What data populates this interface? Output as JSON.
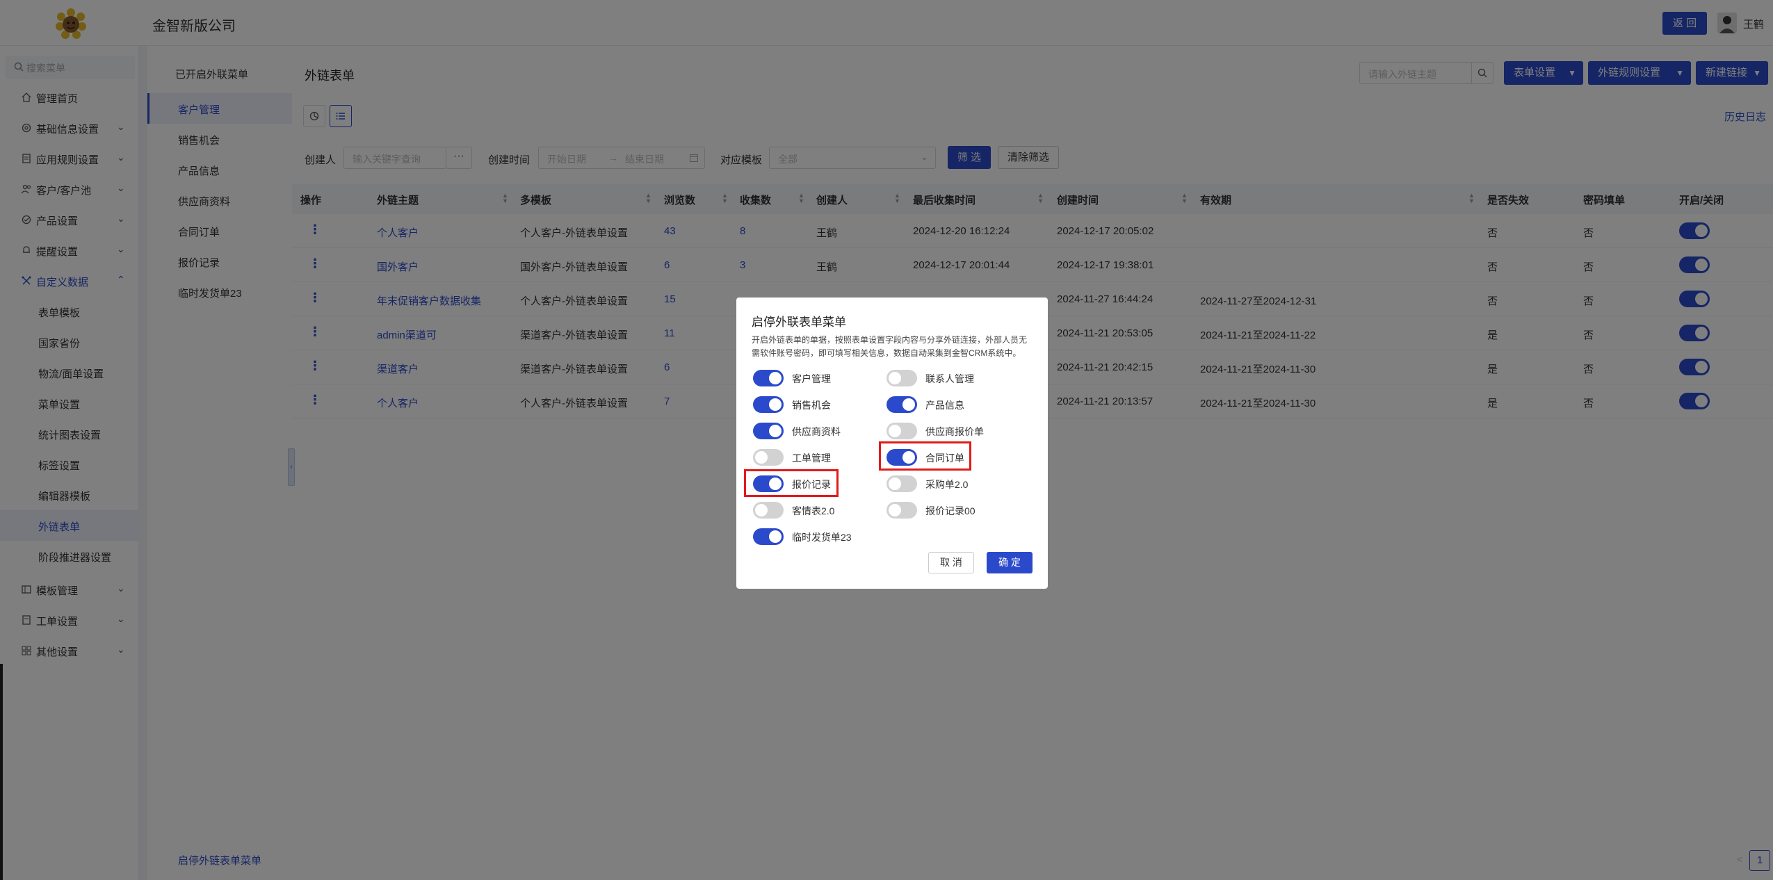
{
  "header": {
    "company": "金智新版公司",
    "back_label": "返 回",
    "username": "王鹤"
  },
  "sidebar": {
    "search_placeholder": "搜索菜单",
    "items": [
      {
        "label": "管理首页",
        "icon": "home-icon"
      },
      {
        "label": "基础信息设置",
        "icon": "settings-icon"
      },
      {
        "label": "应用规则设置",
        "icon": "document-icon"
      },
      {
        "label": "客户/客户池",
        "icon": "users-icon"
      },
      {
        "label": "产品设置",
        "icon": "product-icon"
      },
      {
        "label": "提醒设置",
        "icon": "bell-icon"
      },
      {
        "label": "自定义数据",
        "icon": "custom-data-icon"
      },
      {
        "label": "模板管理",
        "icon": "template-icon"
      },
      {
        "label": "工单设置",
        "icon": "ticket-icon"
      },
      {
        "label": "其他设置",
        "icon": "grid-icon"
      }
    ],
    "sub_items": [
      {
        "label": "表单模板"
      },
      {
        "label": "国家省份"
      },
      {
        "label": "物流/面单设置"
      },
      {
        "label": "菜单设置"
      },
      {
        "label": "统计图表设置"
      },
      {
        "label": "标签设置"
      },
      {
        "label": "编辑器模板"
      },
      {
        "label": "外链表单"
      },
      {
        "label": "阶段推进器设置"
      }
    ],
    "active_sub": "外链表单"
  },
  "menu2": {
    "heading": "已开启外联菜单",
    "items": [
      {
        "label": "客户管理"
      },
      {
        "label": "销售机会"
      },
      {
        "label": "产品信息"
      },
      {
        "label": "供应商资料"
      },
      {
        "label": "合同订单"
      },
      {
        "label": "报价记录"
      },
      {
        "label": "临时发货单23"
      }
    ],
    "footer": "启停外链表单菜单"
  },
  "main": {
    "title": "外链表单",
    "search_placeholder": "请输入外链主题",
    "buttons": {
      "form_settings": "表单设置",
      "link_rules": "外链规则设置",
      "new_link": "新建链接"
    },
    "history": "历史日志",
    "filters": {
      "creator_label": "创建人",
      "creator_placeholder": "输入关键字查询",
      "time_label": "创建时间",
      "start_placeholder": "开始日期",
      "end_placeholder": "结束日期",
      "range_sep": "→",
      "template_label": "对应模板",
      "template_value": "全部",
      "filter_btn": "筛 选",
      "clear_btn": "清除筛选"
    },
    "columns": {
      "op": "操作",
      "topic": "外链主题",
      "template": "多模板",
      "views": "浏览数",
      "collected": "收集数",
      "creator": "创建人",
      "last_collect": "最后收集时间",
      "created": "创建时间",
      "validity": "有效期",
      "expired": "是否失效",
      "password": "密码填单",
      "toggle": "开启/关闭"
    },
    "rows": [
      {
        "topic": "个人客户",
        "template": "个人客户-外链表单设置",
        "views": "43",
        "collected": "8",
        "creator": "王鹤",
        "last_collect": "2024-12-20 16:12:24",
        "created": "2024-12-17 20:05:02",
        "validity": "",
        "expired": "否",
        "password": "否",
        "on": true
      },
      {
        "topic": "国外客户",
        "template": "国外客户-外链表单设置",
        "views": "6",
        "collected": "3",
        "creator": "王鹤",
        "last_collect": "2024-12-17 20:01:44",
        "created": "2024-12-17 19:38:01",
        "validity": "",
        "expired": "否",
        "password": "否",
        "on": true
      },
      {
        "topic": "年末促销客户数据收集",
        "template": "个人客户-外链表单设置",
        "views": "15",
        "collected": "",
        "creator": "",
        "last_collect": "",
        "created": "2024-11-27 16:44:24",
        "validity": "2024-11-27至2024-12-31",
        "expired": "否",
        "password": "否",
        "on": true
      },
      {
        "topic": "admin渠道可",
        "template": "渠道客户-外链表单设置",
        "views": "11",
        "collected": "",
        "creator": "",
        "last_collect": "",
        "created": "2024-11-21 20:53:05",
        "validity": "2024-11-21至2024-11-22",
        "expired": "是",
        "password": "否",
        "on": true
      },
      {
        "topic": "渠道客户",
        "template": "渠道客户-外链表单设置",
        "views": "6",
        "collected": "",
        "creator": "",
        "last_collect": "",
        "created": "2024-11-21 20:42:15",
        "validity": "2024-11-21至2024-11-30",
        "expired": "是",
        "password": "否",
        "on": true
      },
      {
        "topic": "个人客户",
        "template": "个人客户-外链表单设置",
        "views": "7",
        "collected": "",
        "creator": "",
        "last_collect": "",
        "created": "2024-11-21 20:13:57",
        "validity": "2024-11-21至2024-11-30",
        "expired": "是",
        "password": "否",
        "on": true
      }
    ],
    "pager": {
      "prev": "<",
      "page": "1",
      "next": ">"
    }
  },
  "modal": {
    "title": "启停外联表单菜单",
    "description": "开启外链表单的单据，按照表单设置字段内容与分享外链连接，外部人员无需软件账号密码，即可填写相关信息，数据自动采集到金智CRM系统中。",
    "switches": [
      {
        "label": "客户管理",
        "on": true
      },
      {
        "label": "联系人管理",
        "on": false
      },
      {
        "label": "销售机会",
        "on": true
      },
      {
        "label": "产品信息",
        "on": true
      },
      {
        "label": "供应商资料",
        "on": true
      },
      {
        "label": "供应商报价单",
        "on": false
      },
      {
        "label": "工单管理",
        "on": false
      },
      {
        "label": "合同订单",
        "on": true
      },
      {
        "label": "报价记录",
        "on": true
      },
      {
        "label": "采购单2.0",
        "on": false
      },
      {
        "label": "客情表2.0",
        "on": false
      },
      {
        "label": "报价记录00",
        "on": false
      },
      {
        "label": "临时发货单23",
        "on": true
      }
    ],
    "cancel": "取 消",
    "confirm": "确 定"
  },
  "colors": {
    "primary": "#2b4acb",
    "highlight": "#e01b1b",
    "toggle_off": "#d2d2d2"
  }
}
